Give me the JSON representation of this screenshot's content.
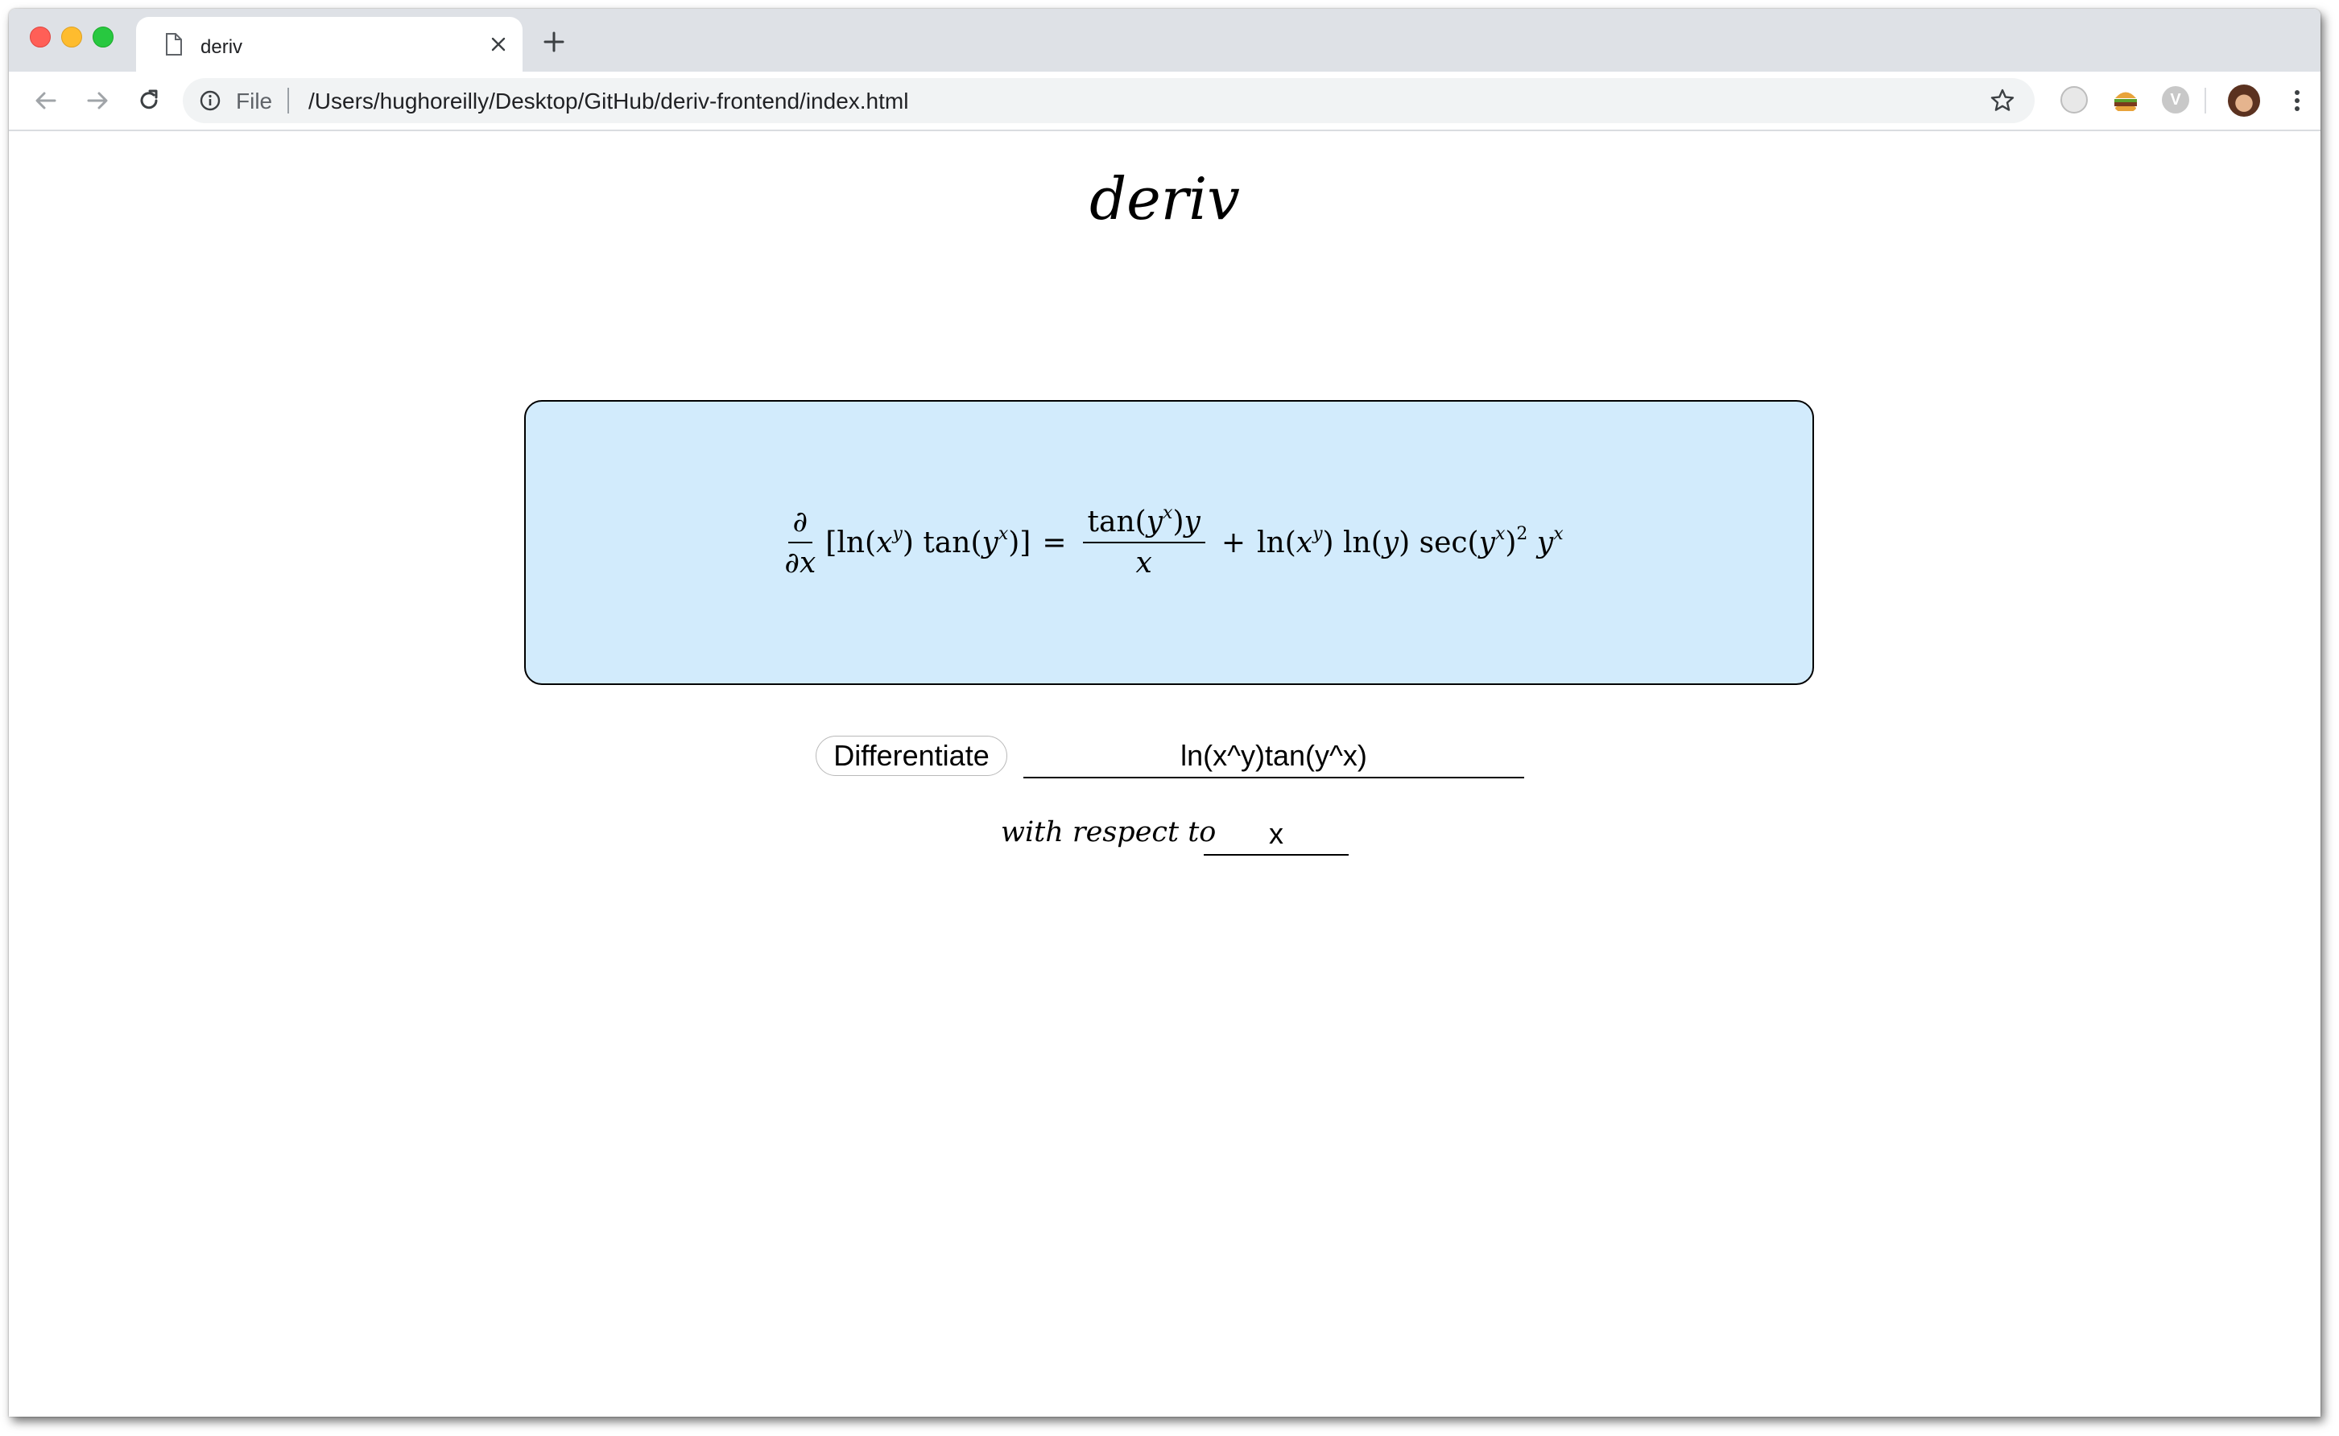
{
  "browser": {
    "tab": {
      "title": "deriv",
      "close_icon": "close-icon",
      "page_icon": "document-icon"
    },
    "new_tab_icon": "plus-icon",
    "nav": {
      "back_icon": "arrow-left-icon",
      "forward_icon": "arrow-right-icon",
      "reload_icon": "reload-icon"
    },
    "omnibox": {
      "info_icon": "info-icon",
      "scheme": "File",
      "url": "/Users/hughoreilly/Desktop/GitHub/deriv-frontend/index.html",
      "bookmark_icon": "star-icon"
    },
    "extensions": [
      {
        "name": "extension-icon-1"
      },
      {
        "name": "burger-extension-icon"
      },
      {
        "name": "extension-icon-v",
        "label": "V"
      }
    ],
    "menu_icon": "kebab-menu-icon"
  },
  "page": {
    "title": "deriv",
    "result": {
      "lhs_operator": {
        "numerator": "∂",
        "denominator": "∂x"
      },
      "lhs_expression": "[ln(x^y) tan(y^x)]",
      "equals": "=",
      "term1": {
        "numerator": "tan(y^x)y",
        "denominator": "x"
      },
      "plus": "+",
      "term2": "ln(x^y) ln(y) sec(y^x)^2 y^x"
    },
    "differentiate_button": "Differentiate",
    "expression_input": "ln(x^y)tan(y^x)",
    "with_respect_to_label": "with respect to",
    "variable_input": "x"
  },
  "colors": {
    "result_background": "#d2ebfc",
    "tabbar_background": "#dee1e6",
    "traffic_red": "#ff5f57",
    "traffic_yellow": "#febc2e",
    "traffic_green": "#28c840"
  }
}
